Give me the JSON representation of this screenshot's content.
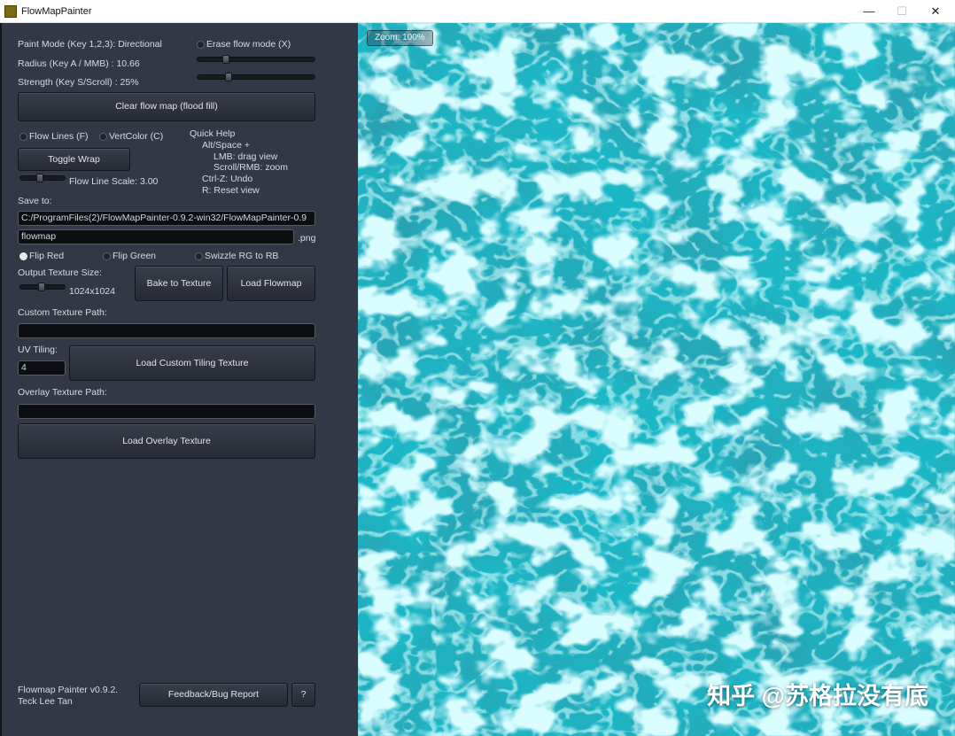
{
  "window": {
    "title": "FlowMapPainter",
    "minimize_glyph": "—",
    "maximize_glyph": "☐",
    "close_glyph": "✕",
    "icon": "app-icon"
  },
  "panel": {
    "paint_mode": "Paint Mode (Key 1,2,3): Directional",
    "erase_mode": "Erase flow mode (X)",
    "erase_mode_checked": false,
    "radius": "Radius (Key A / MMB) : 10.66",
    "radius_value": 0.23,
    "strength": "Strength (Key S/Scroll) : 25%",
    "strength_value": 0.25,
    "clear_button": "Clear flow map (flood fill)",
    "flow_lines": "Flow Lines (F)",
    "flow_lines_checked": false,
    "vert_color": "VertColor (C)",
    "vert_color_checked": false,
    "toggle_wrap": "Toggle Wrap",
    "flow_line_scale": "Flow Line Scale: 3.00",
    "flow_line_scale_value": 0.45,
    "quick_help": {
      "title": "Quick Help",
      "line1": "Alt/Space +",
      "line2": "LMB: drag view",
      "line3": "Scroll/RMB: zoom",
      "line4": "Ctrl-Z: Undo",
      "line5": "R: Reset view"
    },
    "save_to_label": "Save to:",
    "save_path": "C:/ProgramFiles(2)/FlowMapPainter-0.9.2-win32/FlowMapPainter-0.9",
    "filename": "flowmap",
    "extension": ".png",
    "flip_red": "Flip Red",
    "flip_red_checked": true,
    "flip_green": "Flip Green",
    "flip_green_checked": false,
    "swizzle": "Swizzle RG to RB",
    "swizzle_checked": false,
    "output_size_label": "Output Texture Size:",
    "output_size": "1024x1024",
    "output_size_value": 0.5,
    "bake_button": "Bake to Texture",
    "load_flowmap_button": "Load Flowmap",
    "custom_texture_label": "Custom Texture Path:",
    "custom_texture_path": "",
    "uv_tiling_label": "UV Tiling:",
    "uv_tiling_value": "4",
    "load_custom_button": "Load Custom Tiling Texture",
    "overlay_label": "Overlay Texture Path:",
    "overlay_path": "",
    "load_overlay_button": "Load Overlay Texture",
    "version_line1": "Flowmap Painter v0.9.2.",
    "version_line2": "Teck Lee Tan",
    "feedback_button": "Feedback/Bug Report",
    "help_button": "?"
  },
  "viewport": {
    "zoom": "Zoom: 100%",
    "watermark": "知乎 @苏格拉没有底",
    "water_base_color": "#1cb7c6",
    "water_dark_color": "#0f6f7e",
    "caustic_color": "#b6fbff"
  }
}
